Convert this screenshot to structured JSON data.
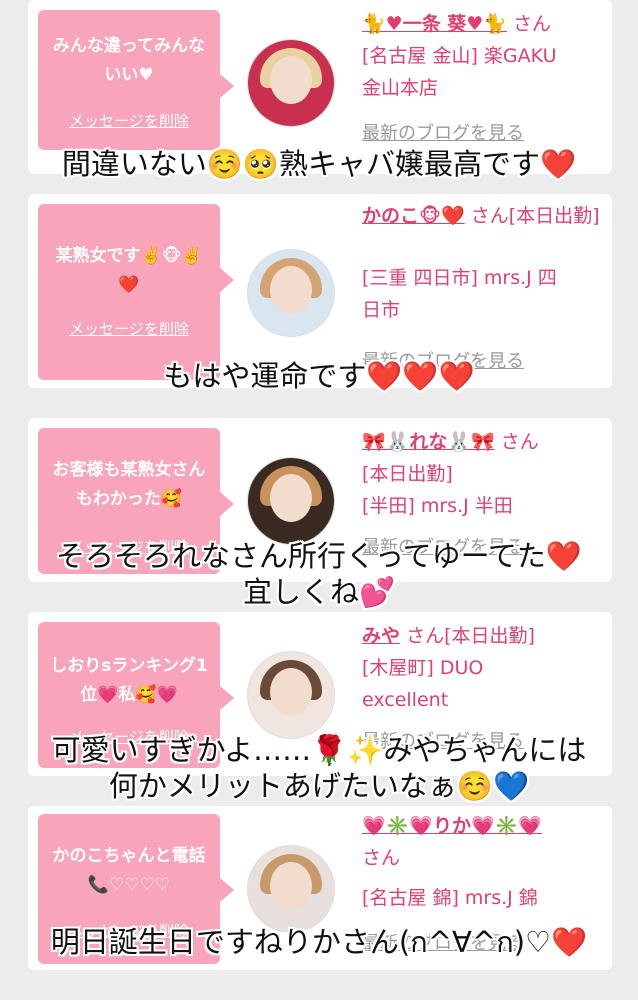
{
  "cards": [
    {
      "message": "みんな違ってみんないい♥",
      "delete_label": "メッセージを削除",
      "name": "🐈♥一条 葵♥🐈",
      "san": "さん",
      "lines": [
        "[名古屋 金山] 楽GAKU",
        "金山本店"
      ],
      "blog_label": "最新のブログを見る",
      "caption": [
        "間違いない☺️🥺熟キャバ嬢最高です❤️"
      ]
    },
    {
      "message": "某熟女です✌️🐵✌️❤️",
      "delete_label": "メッセージを削除",
      "name": "かのこ🐵❤️",
      "san": "さん[本日出勤]",
      "lines": [
        "[三重 四日市] mrs.J 四",
        "日市"
      ],
      "blog_label": "最新のブログを見る",
      "caption": [
        "もはや運命です❤️❤️❤️"
      ]
    },
    {
      "message": "お客様も某熟女さんもわかった🥰",
      "delete_label": "メッセージを削除",
      "name": "🎀🐰れな🐰🎀",
      "san": "さん",
      "lines": [
        "[本日出勤]",
        "[半田] mrs.J 半田"
      ],
      "blog_label": "最新のブログを見る",
      "caption": [
        "そろそろれなさん所行くってゆーてた❤️",
        "宜しくね💕"
      ]
    },
    {
      "message": "しおりsランキング1位💗私🥰💗",
      "delete_label": "メッセージを削除",
      "name": "みや",
      "san": "さん[本日出勤]",
      "lines": [
        "[木屋町] DUO",
        "excellent"
      ],
      "blog_label": "最新のブログを見る",
      "caption": [
        "可愛いすぎかよ……🌹✨みやちゃんには",
        "何かメリットあげたいなぁ☺️💙"
      ]
    },
    {
      "message": "かのこちゃんと電話📞♡♡♡♡",
      "delete_label": "メッセージを削除",
      "name": "💗✳️💗りか💗✳️💗",
      "san": "さん",
      "lines": [
        "[名古屋 錦] mrs.J 錦"
      ],
      "blog_label": "最新のブログを見る",
      "caption": [
        "明日誕生日ですねりかさん(ก^∀^ก)♡❤️"
      ]
    }
  ],
  "colors": {
    "bubble": "#f8a4ba",
    "accent": "#e0406f",
    "background": "#ececec"
  },
  "icons": [
    "avatar-photo"
  ]
}
